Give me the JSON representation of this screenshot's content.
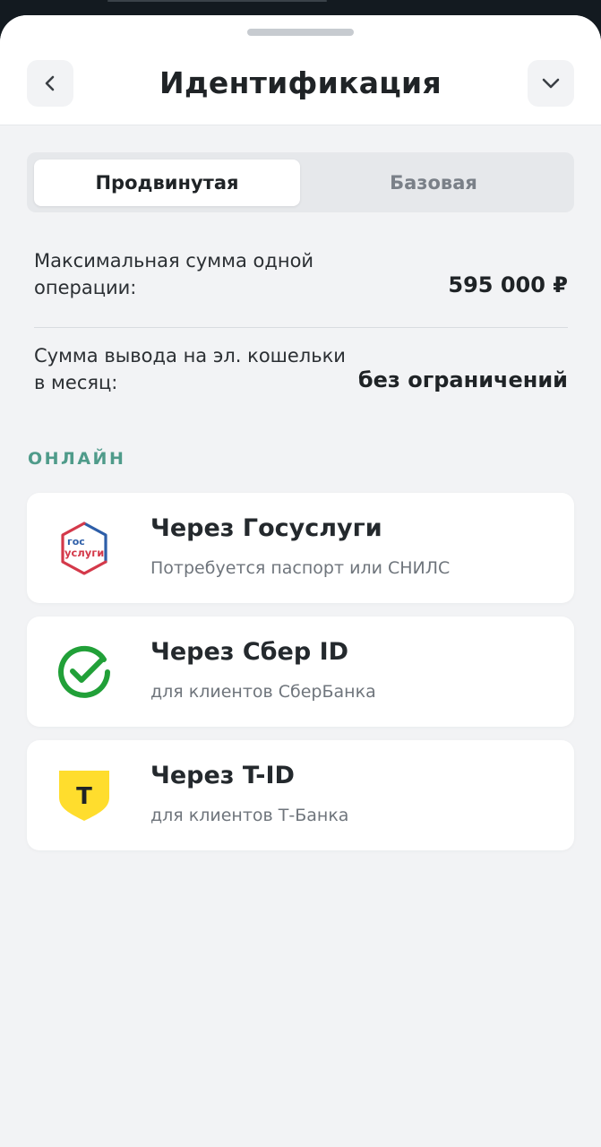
{
  "header": {
    "title": "Идентификация"
  },
  "tabs": [
    {
      "label": "Продвинутая",
      "selected": true
    },
    {
      "label": "Базовая",
      "selected": false
    }
  ],
  "limits": [
    {
      "label": "Максимальная сумма одной операции:",
      "value": "595 000 ₽"
    },
    {
      "label": "Сумма вывода на эл. кошельки в месяц:",
      "value": "без ограничений"
    }
  ],
  "online": {
    "section_title": "ОНЛАЙН",
    "methods": [
      {
        "title": "Через Госуслуги",
        "subtitle": "Потребуется паспорт или СНИЛС",
        "icon": "gosuslugi-logo",
        "logo_text_top": "гос",
        "logo_text_bottom": "услуги"
      },
      {
        "title": "Через Сбер ID",
        "subtitle": "для клиентов СберБанка",
        "icon": "sber-logo"
      },
      {
        "title": "Через T-ID",
        "subtitle": "для клиентов Т-Банка",
        "icon": "tbank-logo",
        "logo_letter": "Т"
      }
    ]
  },
  "colors": {
    "accent_green": "#4f9b8a",
    "sber_green": "#21a038",
    "tbank_yellow": "#ffdd2d",
    "gos_blue": "#2d5ea8",
    "gos_red": "#d4394a"
  }
}
